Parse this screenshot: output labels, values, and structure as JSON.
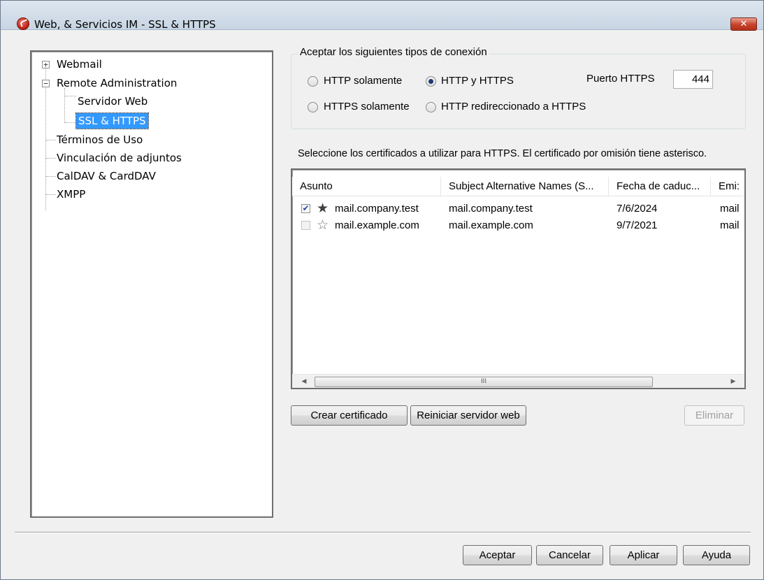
{
  "window": {
    "title": "Web, & Servicios IM - SSL & HTTPS",
    "close_label": "✕"
  },
  "tree": {
    "items": [
      {
        "label": "Webmail",
        "expander": "+"
      },
      {
        "label": "Remote Administration",
        "expander": "−"
      },
      {
        "label": "Servidor Web"
      },
      {
        "label": "SSL & HTTPS",
        "selected": true
      },
      {
        "label": "Términos de Uso"
      },
      {
        "label": "Vinculación de adjuntos"
      },
      {
        "label": "CalDAV & CardDAV"
      },
      {
        "label": "XMPP"
      }
    ]
  },
  "connection": {
    "legend": "Aceptar los siguientes tipos de conexión",
    "options": [
      {
        "label": "HTTP solamente",
        "checked": false
      },
      {
        "label": "HTTP y HTTPS",
        "checked": true
      },
      {
        "label": "HTTPS solamente",
        "checked": false
      },
      {
        "label": "HTTP redireccionado a HTTPS",
        "checked": false
      }
    ],
    "port_label": "Puerto HTTPS",
    "port_value": "444"
  },
  "certificates": {
    "instructions": "Seleccione los certificados a utilizar para HTTPS. El certificado por omisión tiene asterisco.",
    "columns": [
      "Asunto",
      "Subject Alternative Names (S...",
      "Fecha de caduc...",
      "Emi:"
    ],
    "rows": [
      {
        "checked": true,
        "default": true,
        "subject": "mail.company.test",
        "san": "mail.company.test",
        "expires": "7/6/2024",
        "issuer": "mail"
      },
      {
        "checked": false,
        "default": false,
        "subject": "mail.example.com",
        "san": "mail.example.com",
        "expires": "9/7/2021",
        "issuer": "mail"
      }
    ],
    "scroll_left": "◀",
    "scroll_right": "▶",
    "scroll_grip": "III"
  },
  "cert_buttons": {
    "create": "Crear certificado",
    "restart": "Reiniciar servidor web",
    "delete": "Eliminar"
  },
  "footer": {
    "ok": "Aceptar",
    "cancel": "Cancelar",
    "apply": "Aplicar",
    "help": "Ayuda"
  },
  "colors": {
    "selection": "#3399ff",
    "close_button": "#c7422b"
  }
}
